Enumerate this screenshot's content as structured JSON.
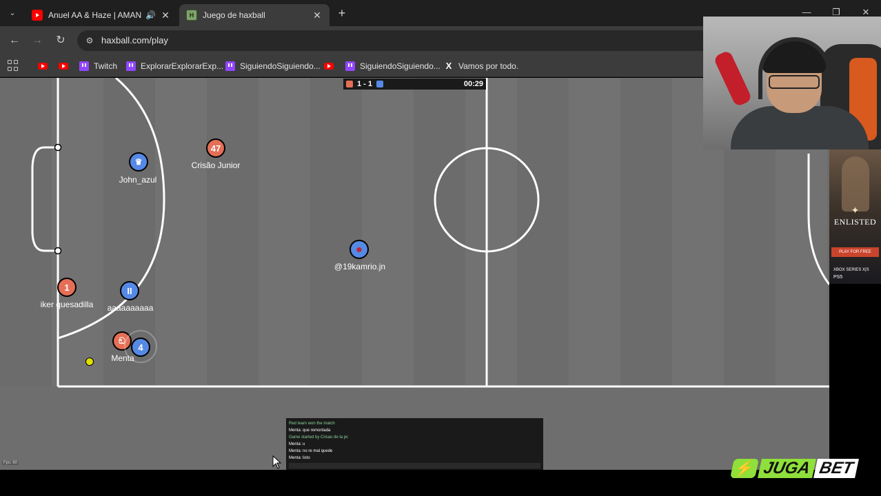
{
  "browser": {
    "tabs": [
      {
        "title": "Anuel AA & Haze | AMANECI",
        "favicon": "youtube-icon",
        "audio": true
      },
      {
        "title": "Juego de haxball",
        "favicon": "haxball-icon",
        "active": true
      }
    ],
    "url": "haxball.com/play",
    "bookmarks": [
      {
        "label": "",
        "icon": "youtube-icon"
      },
      {
        "label": "",
        "icon": "youtube-icon"
      },
      {
        "label": "Twitch",
        "icon": "twitch-icon"
      },
      {
        "label": "ExplorarExplorarExp...",
        "icon": "twitch-icon"
      },
      {
        "label": "SiguiendoSiguiendo...",
        "icon": "twitch-icon"
      },
      {
        "label": "",
        "icon": "youtube-icon"
      },
      {
        "label": "SiguiendoSiguiendo...",
        "icon": "twitch-icon"
      },
      {
        "label": "Vamos por todo.",
        "icon": "x-icon"
      }
    ]
  },
  "game": {
    "score": "1 - 1",
    "time": "00:29",
    "team_colors": {
      "red": "#e56e56",
      "blue": "#5689e5"
    },
    "players": [
      {
        "name": "Crisão Junior",
        "number": "47",
        "team": "red"
      },
      {
        "name": "John_azul",
        "number": "",
        "team": "blue"
      },
      {
        "name": "@19kamrio.jn",
        "number": "",
        "team": "blue"
      },
      {
        "name": "iker quesadilla",
        "number": "1",
        "team": "red"
      },
      {
        "name": "aaaaaaaaaa",
        "number": "II",
        "team": "blue"
      },
      {
        "name": "Menta",
        "number": "ඞ",
        "team": "red"
      },
      {
        "name": "",
        "number": "4",
        "team": "blue"
      }
    ],
    "chat": [
      {
        "text": "Red team won the match",
        "system": true
      },
      {
        "text": "Menta: que remontada",
        "system": false
      },
      {
        "text": "Game started by Crisao de la pc",
        "system": true
      },
      {
        "text": "Menta: u",
        "system": false
      },
      {
        "text": "Menta: no re mal quede",
        "system": false
      },
      {
        "text": "Menta: listo",
        "system": false
      }
    ],
    "fps": "Fps: 60"
  },
  "ad": {
    "title": "ENLISTED",
    "button": "PLAY FOR FREE",
    "platforms1": "XBOX SERIES X|S",
    "platforms2": "PS5"
  },
  "sponsor": {
    "juga": "JUGA",
    "bet": "BET"
  }
}
